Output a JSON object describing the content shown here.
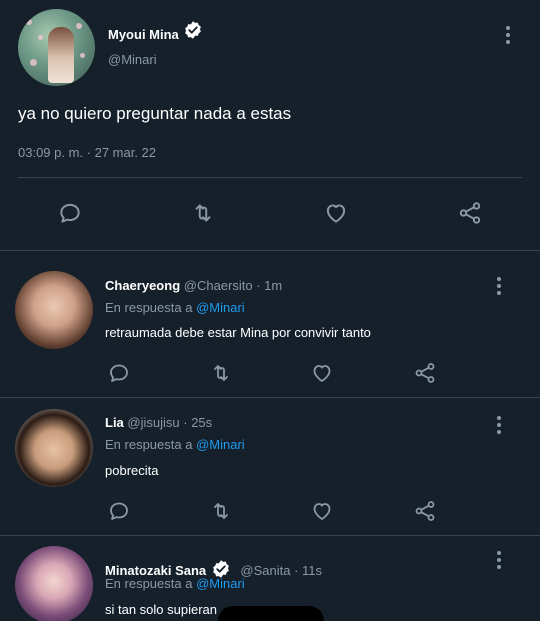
{
  "main_tweet": {
    "author_name": "Myoui Mina",
    "author_handle": "@Minari",
    "text": "ya no quiero preguntar nada a estas",
    "timestamp": "03:09 p. m. · 27 mar. 22",
    "actions": [
      "reply-icon",
      "retweet-icon",
      "like-icon",
      "share-icon"
    ]
  },
  "replies": [
    {
      "name": "Chaeryeong",
      "handle": "@Chaersito",
      "time": "· 1m",
      "verified": false,
      "in_reply_prefix": "En respuesta a",
      "in_reply_to": "@Minari",
      "text": "retraumada debe estar Mina por convivir tanto"
    },
    {
      "name": "Lia",
      "handle": "@jisujisu",
      "time": "· 25s",
      "verified": false,
      "in_reply_prefix": "En respuesta a",
      "in_reply_to": "@Minari",
      "text": "pobrecita"
    },
    {
      "name": "Minatozaki Sana",
      "handle": "@Sanita",
      "time": "· 11s",
      "verified": true,
      "in_reply_prefix": "En respuesta a",
      "in_reply_to": "@Minari",
      "text": "si tan solo supieran"
    }
  ],
  "colors": {
    "background": "#15202b",
    "divider": "#38444d",
    "muted": "#8b98a5",
    "mention": "#1d9bf0"
  }
}
